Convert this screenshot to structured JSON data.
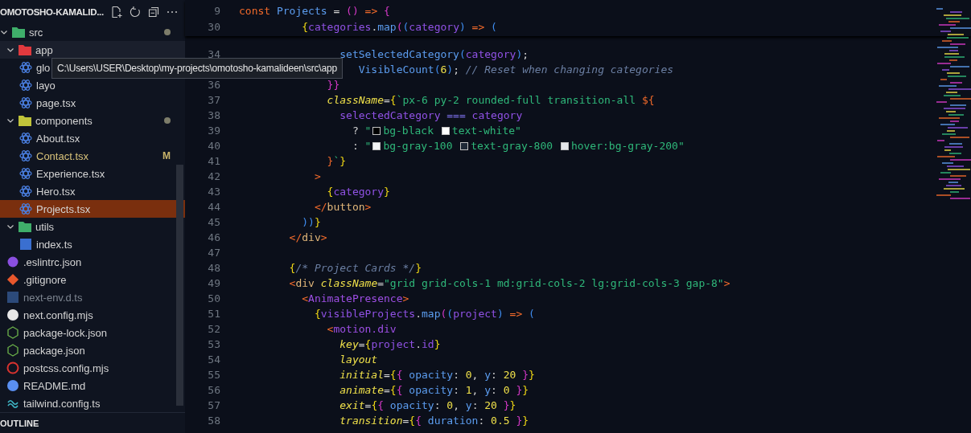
{
  "explorer": {
    "title": "OMOTOSHO-KAMALID...",
    "tree": [
      {
        "name": "src",
        "kind": "folder",
        "color": "#3fae6a",
        "expanded": true,
        "dot": true,
        "selected": false,
        "children": [
          {
            "name": "app",
            "kind": "folder",
            "color": "#e0393e",
            "expanded": true,
            "dot": false,
            "selected": false,
            "children": [
              {
                "name": "glo",
                "kind": "react",
                "modified": false,
                "ignored": false,
                "selected": false
              },
              {
                "name": "layo",
                "kind": "react",
                "modified": false,
                "ignored": false,
                "selected": false
              },
              {
                "name": "page.tsx",
                "kind": "react",
                "modified": false,
                "ignored": false,
                "selected": false
              }
            ]
          },
          {
            "name": "components",
            "kind": "folder",
            "color": "#c0c43a",
            "expanded": true,
            "dot": true,
            "selected": false,
            "children": [
              {
                "name": "About.tsx",
                "kind": "react",
                "modified": false,
                "ignored": false,
                "selected": false
              },
              {
                "name": "Contact.tsx",
                "kind": "react",
                "modified": true,
                "badge": "M",
                "ignored": false,
                "selected": false
              },
              {
                "name": "Experience.tsx",
                "kind": "react",
                "modified": false,
                "ignored": false,
                "selected": false
              },
              {
                "name": "Hero.tsx",
                "kind": "react",
                "modified": false,
                "ignored": false,
                "selected": false
              },
              {
                "name": "Projects.tsx",
                "kind": "react",
                "modified": false,
                "ignored": false,
                "selected": true
              }
            ]
          },
          {
            "name": "utils",
            "kind": "folder",
            "color": "#3fae6a",
            "expanded": true,
            "dot": false,
            "selected": false,
            "children": [
              {
                "name": "index.ts",
                "kind": "ts",
                "modified": false,
                "ignored": false,
                "selected": false
              }
            ]
          }
        ]
      },
      {
        "name": ".eslintrc.json",
        "kind": "eslint",
        "modified": false,
        "ignored": false,
        "selected": false
      },
      {
        "name": ".gitignore",
        "kind": "git",
        "modified": false,
        "ignored": false,
        "selected": false
      },
      {
        "name": "next-env.d.ts",
        "kind": "ts",
        "modified": false,
        "ignored": true,
        "selected": false
      },
      {
        "name": "next.config.mjs",
        "kind": "next",
        "modified": false,
        "ignored": false,
        "selected": false
      },
      {
        "name": "package-lock.json",
        "kind": "node",
        "modified": false,
        "ignored": false,
        "selected": false
      },
      {
        "name": "package.json",
        "kind": "node",
        "modified": false,
        "ignored": false,
        "selected": false
      },
      {
        "name": "postcss.config.mjs",
        "kind": "postcss",
        "modified": false,
        "ignored": false,
        "selected": false
      },
      {
        "name": "README.md",
        "kind": "info",
        "modified": false,
        "ignored": false,
        "selected": false
      },
      {
        "name": "tailwind.config.ts",
        "kind": "tailwind",
        "modified": false,
        "ignored": false,
        "selected": false
      }
    ],
    "tooltip": "C:\\Users\\USER\\Desktop\\my-projects\\omotosho-kamalideen\\src\\app",
    "outline_title": "OUTLINE"
  },
  "editor": {
    "sticky_lines": [
      {
        "number": "9",
        "tokens": [
          {
            "kind": "kw",
            "text": "const"
          },
          {
            "kind": "fn",
            "text": " Projects"
          },
          {
            "kind": "plain",
            "text": " = "
          },
          {
            "kind": "p2",
            "text": "()"
          },
          {
            "kind": "kw",
            "text": " =>"
          },
          {
            "kind": "p2",
            "text": " {"
          }
        ]
      },
      {
        "number": "30",
        "tokens": [
          {
            "kind": "p1",
            "text": "          {"
          },
          {
            "kind": "var",
            "text": "categories"
          },
          {
            "kind": "plain",
            "text": "."
          },
          {
            "kind": "fn",
            "text": "map"
          },
          {
            "kind": "p2",
            "text": "("
          },
          {
            "kind": "p3",
            "text": "("
          },
          {
            "kind": "var",
            "text": "category"
          },
          {
            "kind": "p3",
            "text": ")"
          },
          {
            "kind": "kw",
            "text": " =>"
          },
          {
            "kind": "p3",
            "text": " ("
          }
        ]
      }
    ],
    "lines": [
      {
        "number": "34",
        "tokens": [
          {
            "kind": "fn",
            "text": "                setSelectedCategory"
          },
          {
            "kind": "p3",
            "text": "("
          },
          {
            "kind": "var",
            "text": "category"
          },
          {
            "kind": "p3",
            "text": ")"
          },
          {
            "kind": "plain",
            "text": ";"
          }
        ]
      },
      {
        "tokens": [
          {
            "kind": "fn",
            "text": "                   VisibleCount"
          },
          {
            "kind": "p3",
            "text": "("
          },
          {
            "kind": "num",
            "text": "6"
          },
          {
            "kind": "p3",
            "text": ")"
          },
          {
            "kind": "plain",
            "text": ";"
          },
          {
            "kind": "cmt",
            "text": " // Reset when changing categories"
          }
        ]
      },
      {
        "number": "36",
        "tokens": [
          {
            "kind": "p2",
            "text": "              }}"
          }
        ]
      },
      {
        "number": "37",
        "tokens": [
          {
            "kind": "attr",
            "text": "              className"
          },
          {
            "kind": "plain",
            "text": "="
          },
          {
            "kind": "p1",
            "text": "{"
          },
          {
            "kind": "str",
            "text": "`px-6 py-2 rounded-full transition-all "
          },
          {
            "kind": "kw",
            "text": "${"
          }
        ]
      },
      {
        "number": "38",
        "tokens": [
          {
            "kind": "var",
            "text": "                selectedCategory"
          },
          {
            "kind": "op",
            "text": " ==="
          },
          {
            "kind": "var",
            "text": " category"
          }
        ]
      },
      {
        "number": "39",
        "tokens": [
          {
            "kind": "plain",
            "text": "                  ? "
          },
          {
            "kind": "str",
            "text": "\""
          },
          {
            "kind": "swatch",
            "color": "#000000"
          },
          {
            "kind": "str",
            "text": "bg-black "
          },
          {
            "kind": "swatch",
            "color": "#ffffff"
          },
          {
            "kind": "str",
            "text": "text-white\""
          }
        ]
      },
      {
        "number": "40",
        "tokens": [
          {
            "kind": "plain",
            "text": "                  : "
          },
          {
            "kind": "str",
            "text": "\""
          },
          {
            "kind": "swatch",
            "color": "#f3f4f6"
          },
          {
            "kind": "str",
            "text": "bg-gray-100 "
          },
          {
            "kind": "swatch",
            "color": "#1f2937"
          },
          {
            "kind": "str",
            "text": "text-gray-800 "
          },
          {
            "kind": "swatch",
            "color": "#e5e7eb"
          },
          {
            "kind": "str",
            "text": "hover:bg-gray-200\""
          }
        ]
      },
      {
        "number": "41",
        "tokens": [
          {
            "kind": "kw",
            "text": "              }"
          },
          {
            "kind": "str",
            "text": "`"
          },
          {
            "kind": "p1",
            "text": "}"
          }
        ]
      },
      {
        "number": "42",
        "tokens": [
          {
            "kind": "tag",
            "text": "            >"
          }
        ]
      },
      {
        "number": "43",
        "tokens": [
          {
            "kind": "p1",
            "text": "              {"
          },
          {
            "kind": "var",
            "text": "category"
          },
          {
            "kind": "p1",
            "text": "}"
          }
        ]
      },
      {
        "number": "44",
        "tokens": [
          {
            "kind": "tag",
            "text": "            </"
          },
          {
            "kind": "tagname",
            "text": "button"
          },
          {
            "kind": "tag",
            "text": ">"
          }
        ]
      },
      {
        "number": "45",
        "tokens": [
          {
            "kind": "p3",
            "text": "          ))"
          },
          {
            "kind": "p1",
            "text": "}"
          }
        ]
      },
      {
        "number": "46",
        "tokens": [
          {
            "kind": "tag",
            "text": "        </"
          },
          {
            "kind": "tagname",
            "text": "div"
          },
          {
            "kind": "tag",
            "text": ">"
          }
        ]
      },
      {
        "number": "47"
      },
      {
        "number": "48",
        "tokens": [
          {
            "kind": "p1",
            "text": "        {"
          },
          {
            "kind": "cmt",
            "text": "/* Project Cards */"
          },
          {
            "kind": "p1",
            "text": "}"
          }
        ]
      },
      {
        "number": "49",
        "tokens": [
          {
            "kind": "tag",
            "text": "        <"
          },
          {
            "kind": "tagname",
            "text": "div"
          },
          {
            "kind": "attr",
            "text": " className"
          },
          {
            "kind": "plain",
            "text": "="
          },
          {
            "kind": "str",
            "text": "\"grid grid-cols-1 md:grid-cols-2 lg:grid-cols-3 gap-8\""
          },
          {
            "kind": "tag",
            "text": ">"
          }
        ]
      },
      {
        "number": "50",
        "tokens": [
          {
            "kind": "tag",
            "text": "          <"
          },
          {
            "kind": "comp",
            "text": "AnimatePresence"
          },
          {
            "kind": "tag",
            "text": ">"
          }
        ]
      },
      {
        "number": "51",
        "tokens": [
          {
            "kind": "p1",
            "text": "            {"
          },
          {
            "kind": "var",
            "text": "visibleProjects"
          },
          {
            "kind": "plain",
            "text": "."
          },
          {
            "kind": "fn",
            "text": "map"
          },
          {
            "kind": "p2",
            "text": "("
          },
          {
            "kind": "p3",
            "text": "("
          },
          {
            "kind": "var",
            "text": "project"
          },
          {
            "kind": "p3",
            "text": ")"
          },
          {
            "kind": "kw",
            "text": " =>"
          },
          {
            "kind": "p3",
            "text": " ("
          }
        ]
      },
      {
        "number": "52",
        "tokens": [
          {
            "kind": "tag",
            "text": "              <"
          },
          {
            "kind": "comp",
            "text": "motion.div"
          }
        ]
      },
      {
        "number": "53",
        "tokens": [
          {
            "kind": "attr",
            "text": "                key"
          },
          {
            "kind": "plain",
            "text": "="
          },
          {
            "kind": "p1",
            "text": "{"
          },
          {
            "kind": "var",
            "text": "project"
          },
          {
            "kind": "plain",
            "text": "."
          },
          {
            "kind": "var",
            "text": "id"
          },
          {
            "kind": "p1",
            "text": "}"
          }
        ]
      },
      {
        "number": "54",
        "tokens": [
          {
            "kind": "attr",
            "text": "                layout"
          }
        ]
      },
      {
        "number": "55",
        "tokens": [
          {
            "kind": "attr",
            "text": "                initial"
          },
          {
            "kind": "plain",
            "text": "="
          },
          {
            "kind": "p1",
            "text": "{"
          },
          {
            "kind": "p2",
            "text": "{"
          },
          {
            "kind": "fn",
            "text": " opacity"
          },
          {
            "kind": "plain",
            "text": ": "
          },
          {
            "kind": "num",
            "text": "0"
          },
          {
            "kind": "plain",
            "text": ", "
          },
          {
            "kind": "fn",
            "text": "y"
          },
          {
            "kind": "plain",
            "text": ": "
          },
          {
            "kind": "num",
            "text": "20"
          },
          {
            "kind": "p2",
            "text": " }"
          },
          {
            "kind": "p1",
            "text": "}"
          }
        ]
      },
      {
        "number": "56",
        "tokens": [
          {
            "kind": "attr",
            "text": "                animate"
          },
          {
            "kind": "plain",
            "text": "="
          },
          {
            "kind": "p1",
            "text": "{"
          },
          {
            "kind": "p2",
            "text": "{"
          },
          {
            "kind": "fn",
            "text": " opacity"
          },
          {
            "kind": "plain",
            "text": ": "
          },
          {
            "kind": "num",
            "text": "1"
          },
          {
            "kind": "plain",
            "text": ", "
          },
          {
            "kind": "fn",
            "text": "y"
          },
          {
            "kind": "plain",
            "text": ": "
          },
          {
            "kind": "num",
            "text": "0"
          },
          {
            "kind": "p2",
            "text": " }"
          },
          {
            "kind": "p1",
            "text": "}"
          }
        ]
      },
      {
        "number": "57",
        "tokens": [
          {
            "kind": "attr",
            "text": "                exit"
          },
          {
            "kind": "plain",
            "text": "="
          },
          {
            "kind": "p1",
            "text": "{"
          },
          {
            "kind": "p2",
            "text": "{"
          },
          {
            "kind": "fn",
            "text": " opacity"
          },
          {
            "kind": "plain",
            "text": ": "
          },
          {
            "kind": "num",
            "text": "0"
          },
          {
            "kind": "plain",
            "text": ", "
          },
          {
            "kind": "fn",
            "text": "y"
          },
          {
            "kind": "plain",
            "text": ": "
          },
          {
            "kind": "num",
            "text": "20"
          },
          {
            "kind": "p2",
            "text": " }"
          },
          {
            "kind": "p1",
            "text": "}"
          }
        ]
      },
      {
        "number": "58",
        "tokens": [
          {
            "kind": "attr",
            "text": "                transition"
          },
          {
            "kind": "plain",
            "text": "="
          },
          {
            "kind": "p1",
            "text": "{"
          },
          {
            "kind": "p2",
            "text": "{"
          },
          {
            "kind": "fn",
            "text": " duration"
          },
          {
            "kind": "plain",
            "text": ": "
          },
          {
            "kind": "num",
            "text": "0.5"
          },
          {
            "kind": "p2",
            "text": " }"
          },
          {
            "kind": "p1",
            "text": "}"
          }
        ]
      }
    ]
  }
}
